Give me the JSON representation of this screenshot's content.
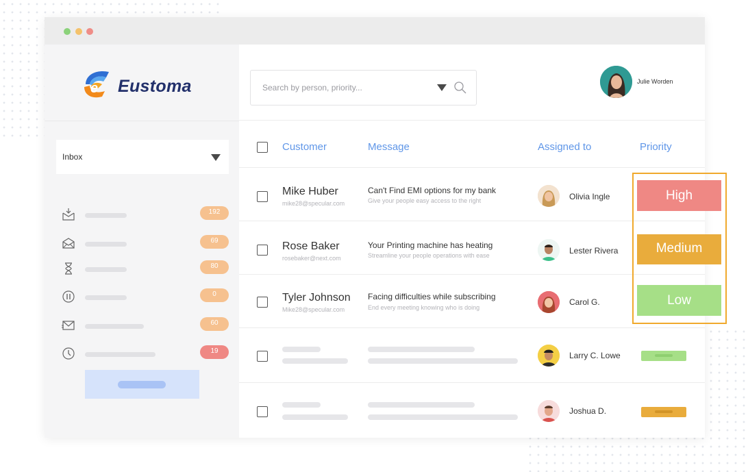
{
  "colors": {
    "accent": "#5f96e8",
    "high": "#ef8884",
    "medium": "#e9ac3c",
    "low": "#a6df87",
    "highlight": "#f0a92c"
  },
  "brand": {
    "name": "Eustoma",
    "icon": "eustoma-logo"
  },
  "sidebar": {
    "folder_select": {
      "value": "Inbox",
      "icon": "triangle-down-icon"
    },
    "items": [
      {
        "icon": "inbox-tray-icon",
        "count": "192",
        "badge_color": "#f6c18f"
      },
      {
        "icon": "open-envelope-icon",
        "count": "69",
        "badge_color": "#f6c18f"
      },
      {
        "icon": "hourglass-icon",
        "count": "80",
        "badge_color": "#f6c18f"
      },
      {
        "icon": "pause-icon",
        "count": "0",
        "badge_color": "#f6c18f"
      },
      {
        "icon": "envelope-icon",
        "count": "60",
        "badge_color": "#f6c18f"
      },
      {
        "icon": "clock-icon",
        "count": "19",
        "badge_color": "#ef8884"
      }
    ]
  },
  "header": {
    "search": {
      "placeholder": "Search by person, priority...",
      "icons": [
        "triangle-down-icon",
        "search-icon"
      ]
    },
    "user": {
      "name": "Julie Worden"
    }
  },
  "table": {
    "columns": [
      "Customer",
      "Message",
      "Assigned to",
      "Priority"
    ],
    "rows": [
      {
        "customer": "Mike Huber",
        "email": "mike28@specular.com",
        "message": "Can't Find EMI options for my bank",
        "message_sub": "Give your people easy access to the right",
        "assignee": "Olivia Ingle",
        "priority": "High"
      },
      {
        "customer": "Rose Baker",
        "email": "rosebaker@next.com",
        "message": "Your Printing machine has heating",
        "message_sub": "Streamline your people operations with ease",
        "assignee": "Lester Rivera",
        "priority": "Medium"
      },
      {
        "customer": "Tyler Johnson",
        "email": "Mike28@specular.com",
        "message": "Facing difficulties while subscribing",
        "message_sub": "End every meeting knowing who is doing",
        "assignee": "Carol G.",
        "priority": "Low"
      },
      {
        "customer": "",
        "email": "",
        "message": "",
        "message_sub": "",
        "assignee": "Larry C. Lowe",
        "priority_level": "low"
      },
      {
        "customer": "",
        "email": "",
        "message": "",
        "message_sub": "",
        "assignee": "Joshua D.",
        "priority_level": "medium"
      }
    ]
  }
}
